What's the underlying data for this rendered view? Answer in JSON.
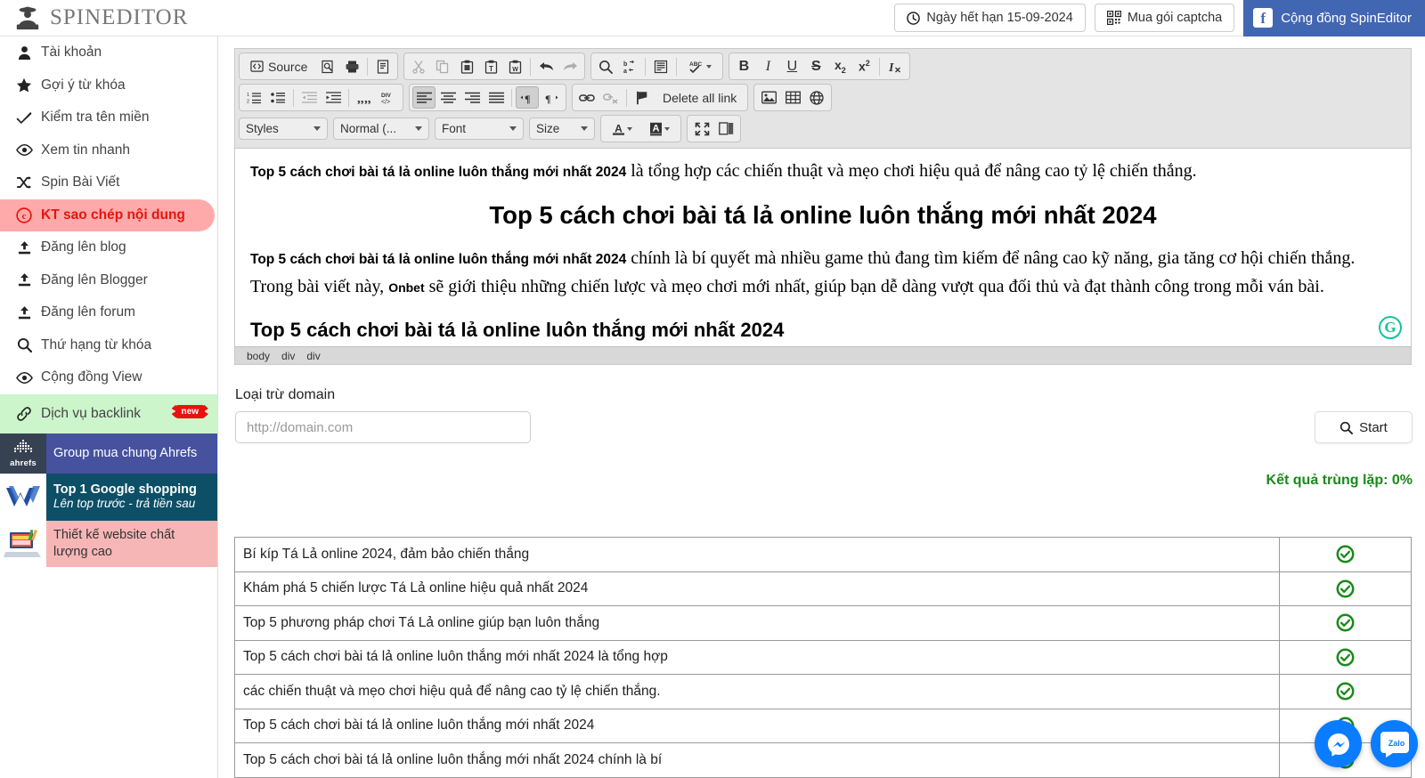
{
  "header": {
    "brand": "SPINEDITOR",
    "logo_icon": "spy-logo-icon",
    "actions": {
      "expiry_icon": "clock-icon",
      "expiry_label": "Ngày hết hạn 15-09-2024",
      "captcha_icon": "qrcode-icon",
      "captcha_label": "Mua gói captcha",
      "facebook_icon": "facebook-icon",
      "facebook_label": "Cộng đồng SpinEditor"
    }
  },
  "sidebar": {
    "items": [
      {
        "icon": "user-icon",
        "label": "Tài khoản",
        "active": false
      },
      {
        "icon": "star-icon",
        "label": "Gợi ý từ khóa",
        "active": false
      },
      {
        "icon": "check-icon",
        "label": "Kiểm tra tên miền",
        "active": false
      },
      {
        "icon": "eye-icon",
        "label": "Xem tin nhanh",
        "active": false
      },
      {
        "icon": "shuffle-icon",
        "label": "Spin Bài Viết",
        "active": false
      },
      {
        "icon": "copyright-icon",
        "label": "KT sao chép nội dung",
        "active": true
      },
      {
        "icon": "upload-icon",
        "label": "Đăng lên blog",
        "active": false
      },
      {
        "icon": "upload-icon",
        "label": "Đăng lên Blogger",
        "active": false
      },
      {
        "icon": "upload-icon",
        "label": "Đăng lên forum",
        "active": false
      },
      {
        "icon": "search-icon",
        "label": "Thứ hạng từ khóa",
        "active": false
      },
      {
        "icon": "eye-icon",
        "label": "Cộng đồng View",
        "active": false
      }
    ],
    "backlink": {
      "icon": "link-icon",
      "label": "Dịch vụ backlink",
      "badge": "new"
    },
    "promos": [
      {
        "thumb_label": "ahrefs",
        "title": "Group mua chung Ahrefs",
        "subtitle": ""
      },
      {
        "thumb_label": "W",
        "title": "Top 1 Google shopping",
        "subtitle": "Lên top trước - trả tiền sau"
      },
      {
        "thumb_label": "",
        "title": "Thiết kế website chất lượng cao",
        "subtitle": ""
      }
    ]
  },
  "editor": {
    "toolbar": {
      "row1": {
        "source_label": "Source",
        "group1": [
          "source-icon",
          "preview-icon",
          "print-icon",
          "templates-icon"
        ],
        "group2": [
          "cut-icon",
          "copy-icon",
          "paste-icon",
          "paste-text-icon",
          "paste-word-icon",
          "undo-icon",
          "redo-icon"
        ],
        "group3": [
          "find-icon",
          "replace-icon",
          "select-all-icon",
          "spellcheck-icon"
        ],
        "group4": [
          "bold-icon",
          "italic-icon",
          "underline-icon",
          "strike-icon",
          "subscript-icon",
          "superscript-icon",
          "remove-format-icon"
        ]
      },
      "row2": {
        "group1": [
          "numbered-list-icon",
          "bulleted-list-icon",
          "outdent-icon",
          "indent-icon",
          "blockquote-icon",
          "div-container-icon"
        ],
        "group2": [
          "align-left-icon",
          "align-center-icon",
          "align-right-icon",
          "justify-icon",
          "ltr-icon",
          "rtl-icon"
        ],
        "group3": [
          "link-icon",
          "unlink-icon",
          "anchor-icon"
        ],
        "delete_all_link_label": "Delete all link",
        "group4": [
          "image-icon",
          "table-icon",
          "iframe-icon"
        ]
      },
      "row3": {
        "styles_label": "Styles",
        "format_label": "Normal (...",
        "font_label": "Font",
        "size_label": "Size",
        "text_color_icon": "text-color-icon",
        "bg_color_icon": "background-color-icon",
        "maximize_icon": "maximize-icon",
        "blocks_icon": "show-blocks-icon"
      }
    },
    "content": {
      "paragraph1_keyword": "Top 5 cách chơi bài tá lả online luôn thắng mới nhất 2024",
      "paragraph1_rest": " là tổng hợp các chiến thuật và mẹo chơi hiệu quả để nâng cao tỷ lệ chiến thắng.",
      "heading1": "Top 5 cách chơi bài tá lả online luôn thắng mới nhất 2024",
      "paragraph2_keyword": "Top 5 cách chơi bài tá lả online luôn thắng mới nhất 2024",
      "paragraph2_rest": " chính là bí quyết mà nhiều game thủ đang tìm kiếm để nâng cao kỹ năng, gia tăng cơ hội chiến thắng.",
      "paragraph3_pre": "Trong bài viết này, ",
      "paragraph3_brand": "Onbet",
      "paragraph3_rest": " sẽ giới thiệu những chiến lược và mẹo chơi mới nhất, giúp bạn dễ dàng vượt qua đối thủ và đạt thành công trong mỗi ván bài.",
      "heading2": "Top 5 cách chơi bài tá lả online luôn thắng mới nhất 2024",
      "grammarly_icon": "grammarly-icon"
    },
    "breadcrumb": [
      "body",
      "div",
      "div"
    ]
  },
  "form": {
    "exclude_domain_label": "Loại trừ domain",
    "domain_placeholder": "http://domain.com",
    "domain_value": "",
    "start_icon": "search-icon",
    "start_label": "Start",
    "duplicate_result": "Kết quả trùng lặp: 0%"
  },
  "results": {
    "status_icon": "check-circle-icon",
    "rows": [
      {
        "text": "Bí kíp Tá Lả online 2024, đảm bảo chiến thắng",
        "status": "ok"
      },
      {
        "text": "Khám phá 5 chiến lược Tá Lả online hiệu quả nhất 2024",
        "status": "ok"
      },
      {
        "text": "Top 5 phương pháp chơi Tá Lả online giúp bạn luôn thắng",
        "status": "ok"
      },
      {
        "text": "Top 5 cách chơi bài tá lả online luôn thắng mới nhất 2024 là tổng hợp",
        "status": "ok"
      },
      {
        "text": "các chiến thuật và mẹo chơi hiệu quả để nâng cao tỷ lệ chiến thắng.",
        "status": "ok"
      },
      {
        "text": "Top 5 cách chơi bài tá lả online luôn thắng mới nhất 2024",
        "status": "ok"
      },
      {
        "text": "Top 5 cách chơi bài tá lả online luôn thắng mới nhất 2024 chính là bí",
        "status": "ok"
      }
    ]
  },
  "chat": {
    "messenger_icon": "messenger-icon",
    "zalo_icon": "zalo-icon",
    "zalo_label": "Zalo"
  },
  "colors": {
    "accent_red": "#e8130f",
    "facebook_blue": "#4267B2",
    "success_green": "#1a8a1a",
    "chat_blue": "#0a7cff"
  }
}
